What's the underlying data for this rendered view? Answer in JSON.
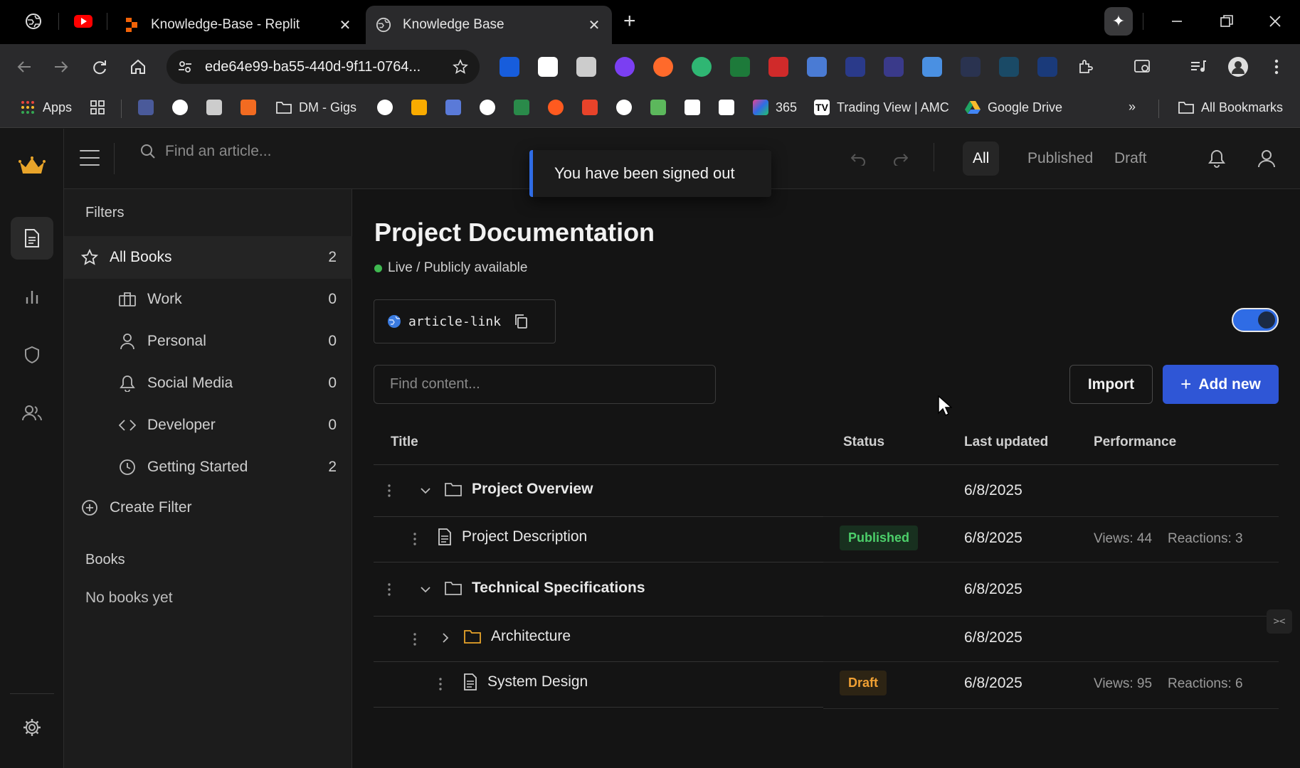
{
  "browser": {
    "tabs": [
      {
        "title": "Knowledge-Base - Replit"
      },
      {
        "title": "Knowledge Base"
      }
    ],
    "url": "ede64e99-ba55-440d-9f11-0764...",
    "bookmarks": {
      "apps": "Apps",
      "dm_gigs": "DM - Gigs",
      "m365": "365",
      "tradingview": "Trading View | AMC",
      "google_drive": "Google Drive",
      "all_bookmarks": "All Bookmarks"
    },
    "colors": {
      "accent_orange": "#f26207",
      "youtube_red": "#ff0000"
    }
  },
  "app": {
    "search_placeholder": "Find an article...",
    "view_tabs": {
      "all": "All",
      "published": "Published",
      "draft": "Draft"
    },
    "toast": "You have been signed out",
    "filters": {
      "title": "Filters",
      "items": [
        {
          "label": "All Books",
          "count": "2",
          "icon": "star-icon"
        },
        {
          "label": "Work",
          "count": "0",
          "icon": "briefcase-icon"
        },
        {
          "label": "Personal",
          "count": "0",
          "icon": "person-icon"
        },
        {
          "label": "Social Media",
          "count": "0",
          "icon": "bell-icon"
        },
        {
          "label": "Developer",
          "count": "0",
          "icon": "code-icon"
        },
        {
          "label": "Getting Started",
          "count": "2",
          "icon": "clock-icon"
        }
      ],
      "create_filter": "Create Filter",
      "books_title": "Books",
      "no_books": "No books yet"
    },
    "project": {
      "title": "Project Documentation",
      "status": "Live / Publicly available",
      "link_label": "article-link",
      "public_toggle_on": true,
      "content_search_placeholder": "Find content...",
      "import_label": "Import",
      "add_new_label": "Add new"
    },
    "table": {
      "columns": {
        "title": "Title",
        "status": "Status",
        "last_updated": "Last updated",
        "performance": "Performance"
      },
      "rows": [
        {
          "type": "folder",
          "expanded": true,
          "title": "Project Overview",
          "status": "",
          "updated": "6/8/2025",
          "views": "",
          "reactions": ""
        },
        {
          "type": "article",
          "title": "Project Description",
          "status": "Published",
          "updated": "6/8/2025",
          "views": "Views: 44",
          "reactions": "Reactions: 3"
        },
        {
          "type": "folder",
          "expanded": true,
          "title": "Technical Specifications",
          "status": "",
          "updated": "6/8/2025",
          "views": "",
          "reactions": ""
        },
        {
          "type": "folder",
          "expanded": false,
          "title": "Architecture",
          "status": "",
          "updated": "6/8/2025",
          "views": "",
          "reactions": ""
        },
        {
          "type": "article",
          "title": "System Design",
          "status": "Draft",
          "updated": "6/8/2025",
          "views": "Views: 95",
          "reactions": "Reactions: 6"
        }
      ]
    },
    "colors": {
      "primary": "#2f56d6",
      "published": "#4ccf6a",
      "draft": "#f0a033",
      "live_dot": "#3fb950",
      "logo_gold": "#e8a42a"
    }
  }
}
